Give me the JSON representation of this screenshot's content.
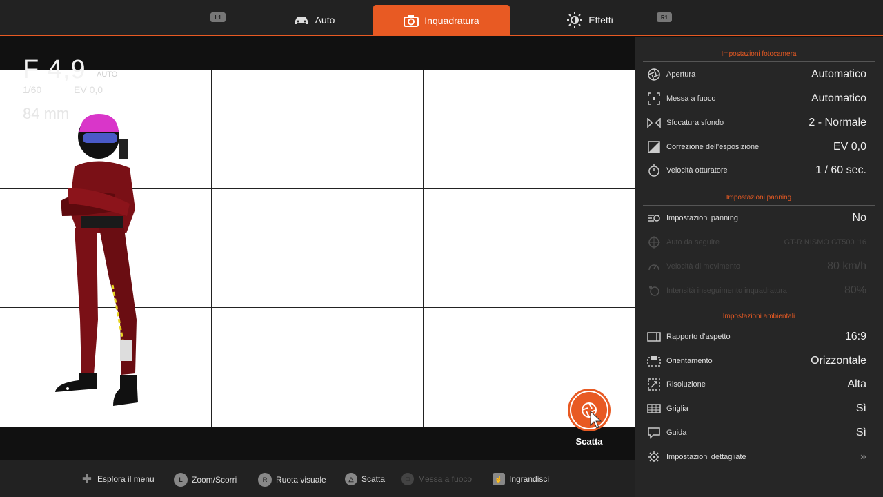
{
  "tabs": {
    "l1": "L1",
    "r1": "R1",
    "items": [
      {
        "label": "Auto",
        "icon": "car-icon"
      },
      {
        "label": "Inquadratura",
        "icon": "camera-icon"
      },
      {
        "label": "Effetti",
        "icon": "brightness-icon"
      }
    ]
  },
  "hud": {
    "aperture": "F 4,9",
    "mode": "AUTO",
    "shutter": "1/60",
    "ev": "EV 0,0",
    "focal": "84 mm"
  },
  "shoot": {
    "label": "Scatta"
  },
  "panel": {
    "camera_title": "Impostazioni fotocamera",
    "camera": [
      {
        "label": "Apertura",
        "value": "Automatico"
      },
      {
        "label": "Messa a fuoco",
        "value": "Automatico"
      },
      {
        "label": "Sfocatura sfondo",
        "value": "2 - Normale"
      },
      {
        "label": "Correzione dell'esposizione",
        "value": "EV 0,0"
      },
      {
        "label": "Velocità otturatore",
        "value": "1 / 60 sec."
      }
    ],
    "panning_title": "Impostazioni panning",
    "panning": [
      {
        "label": "Impostazioni panning",
        "value": "No"
      },
      {
        "label": "Auto da seguire",
        "value": "GT-R NISMO GT500 '16"
      },
      {
        "label": "Velocità di movimento",
        "value": "80 km/h"
      },
      {
        "label": "Intensità inseguimento inquadratura",
        "value": "80%"
      }
    ],
    "env_title": "Impostazioni ambientali",
    "env": [
      {
        "label": "Rapporto d'aspetto",
        "value": "16:9"
      },
      {
        "label": "Orientamento",
        "value": "Orizzontale"
      },
      {
        "label": "Risoluzione",
        "value": "Alta"
      },
      {
        "label": "Griglia",
        "value": "Sì"
      },
      {
        "label": "Guida",
        "value": "Sì"
      }
    ],
    "detailed": {
      "label": "Impostazioni dettagliate",
      "value": "»"
    }
  },
  "hints": [
    {
      "label": "Esplora il menu",
      "glyph": "✚"
    },
    {
      "label": "Zoom/Scorri",
      "glyph": "L"
    },
    {
      "label": "Ruota visuale",
      "glyph": "R"
    },
    {
      "label": "Scatta",
      "glyph": "△"
    },
    {
      "label": "Messa a fuoco",
      "glyph": "□"
    },
    {
      "label": "Ingrandisci",
      "glyph": "☝"
    }
  ],
  "colors": {
    "accent": "#e85a23",
    "panel": "#262626",
    "bar": "#222222"
  }
}
